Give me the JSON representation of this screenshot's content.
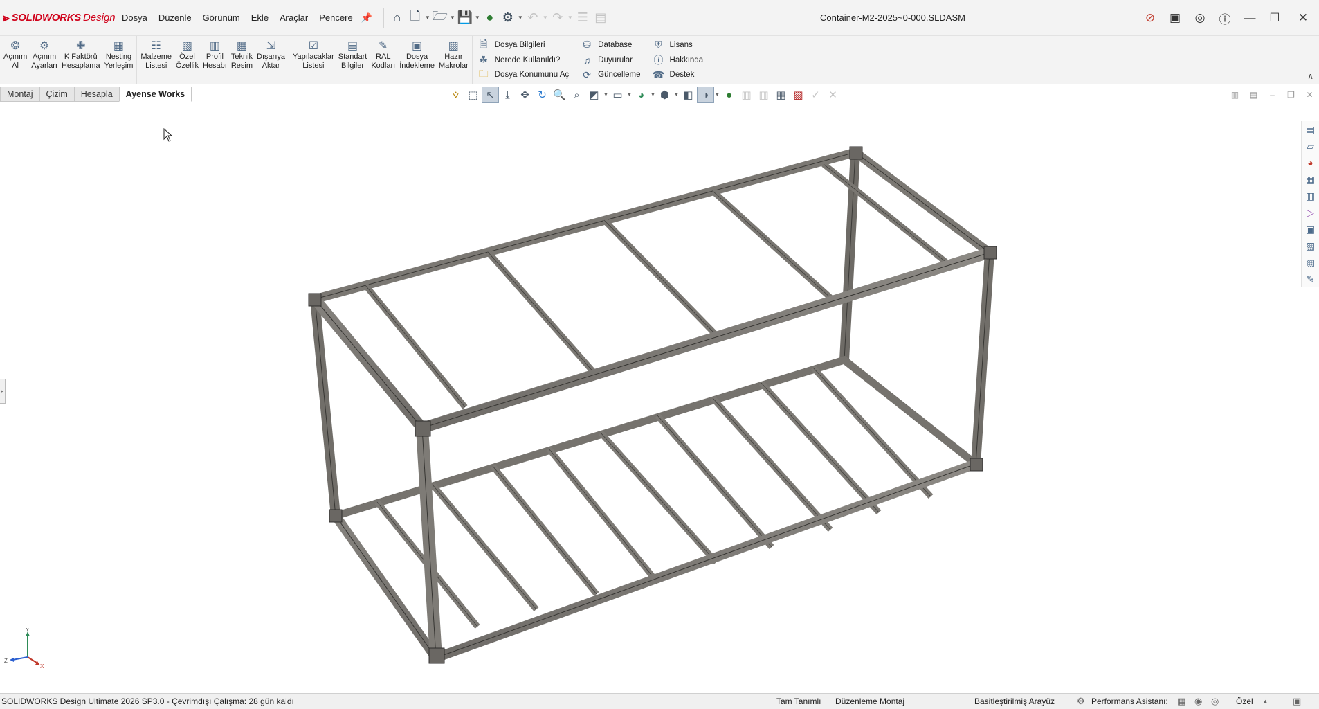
{
  "app": {
    "brand_name": "SOLIDWORKS",
    "brand_suffix": "Design",
    "doc_title": "Container-M2-2025~0-000.SLDASM"
  },
  "menu": [
    "Dosya",
    "Düzenle",
    "Görünüm",
    "Ekle",
    "Araçlar",
    "Pencere"
  ],
  "ribbon": {
    "group1": [
      {
        "label": "Açınım\nAl",
        "icon": "unfold-icon"
      },
      {
        "label": "Açınım\nAyarları",
        "icon": "gear-icon"
      },
      {
        "label": "K Faktörü\nHesaplama",
        "icon": "k-factor-icon"
      },
      {
        "label": "Nesting\nYerleşim",
        "icon": "nesting-icon"
      }
    ],
    "group2": [
      {
        "label": "Malzeme\nListesi",
        "icon": "bom-icon"
      },
      {
        "label": "Özel\nÖzellik",
        "icon": "custom-property-icon"
      },
      {
        "label": "Profil\nHesabı",
        "icon": "profile-icon"
      },
      {
        "label": "Teknik\nResim",
        "icon": "drawing-icon"
      },
      {
        "label": "Dışarıya\nAktar",
        "icon": "export-icon"
      }
    ],
    "group3": [
      {
        "label": "Yapılacaklar\nListesi",
        "icon": "todo-icon"
      },
      {
        "label": "Standart\nBilgiler",
        "icon": "book-icon"
      },
      {
        "label": "RAL\nKodları",
        "icon": "paint-icon"
      },
      {
        "label": "Dosya\nİndekleme",
        "icon": "index-icon"
      },
      {
        "label": "Hazır\nMakrolar",
        "icon": "macro-icon"
      }
    ],
    "list1": [
      {
        "label": "Dosya Bilgileri",
        "icon": "file-info-icon"
      },
      {
        "label": "Nerede Kullanıldı?",
        "icon": "where-used-icon"
      },
      {
        "label": "Dosya Konumunu Aç",
        "icon": "folder-icon"
      }
    ],
    "list2": [
      {
        "label": "Database",
        "icon": "database-icon"
      },
      {
        "label": "Duyurular",
        "icon": "megaphone-icon"
      },
      {
        "label": "Güncelleme",
        "icon": "update-icon"
      }
    ],
    "list3": [
      {
        "label": "Lisans",
        "icon": "shield-icon"
      },
      {
        "label": "Hakkında",
        "icon": "info-icon"
      },
      {
        "label": "Destek",
        "icon": "support-icon"
      }
    ]
  },
  "tabs": [
    "Montaj",
    "Çizim",
    "Hesapla",
    "Ayense Works"
  ],
  "status": {
    "left": "SOLIDWORKS Design Ultimate 2026 SP3.0 - Çevrimdışı Çalışma: 28 gün kaldı",
    "definition": "Tam Tanımlı",
    "mode": "Düzenleme Montaj",
    "ui": "Basitleştirilmiş Arayüz",
    "perf": "Performans Asistanı:",
    "units": "Özel"
  },
  "triad": {
    "y": "Y",
    "z": "Z",
    "x": "X"
  }
}
